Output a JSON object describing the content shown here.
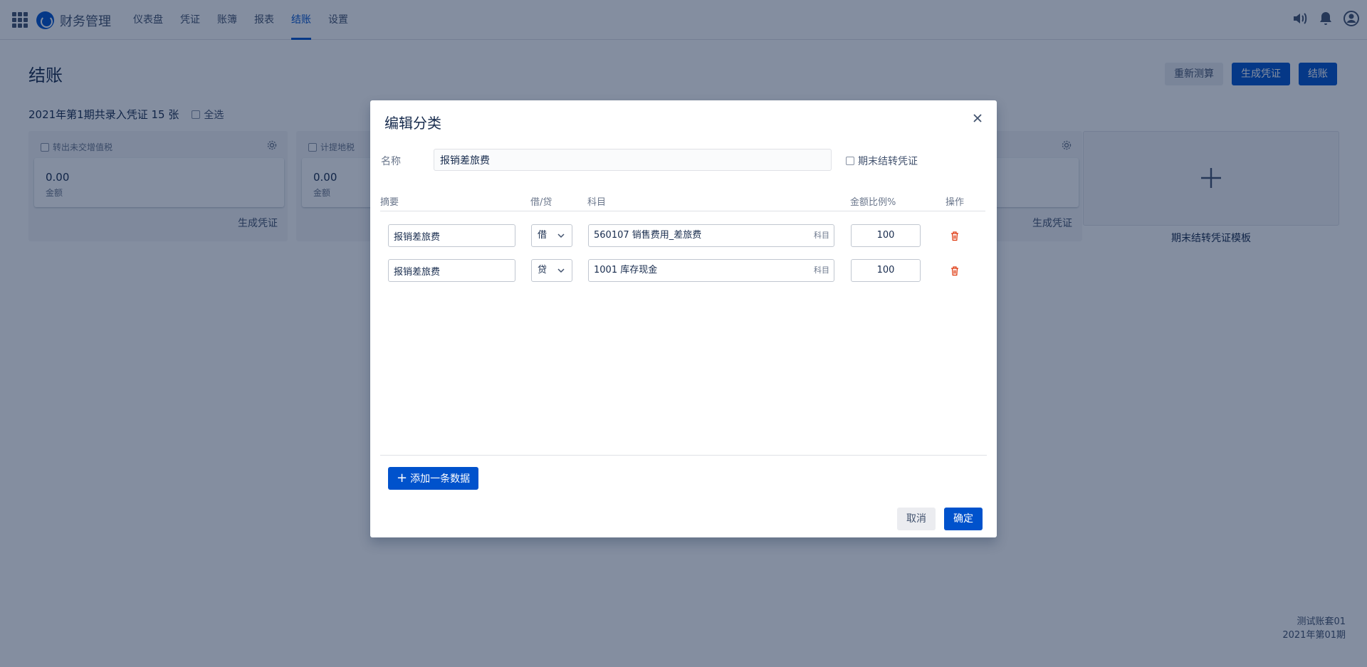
{
  "app": {
    "name": "财务管理"
  },
  "nav": [
    {
      "label": "仪表盘",
      "active": false
    },
    {
      "label": "凭证",
      "active": false
    },
    {
      "label": "账簿",
      "active": false
    },
    {
      "label": "报表",
      "active": false
    },
    {
      "label": "结账",
      "active": true
    },
    {
      "label": "设置",
      "active": false
    }
  ],
  "page": {
    "title": "结账",
    "actions": {
      "recalc": "重新测算",
      "generate": "生成凭证",
      "close": "结账"
    },
    "period_summary": "2021年第1期共录入凭证 15 张",
    "select_all": "全选"
  },
  "cards": [
    {
      "title": "转出未交增值税",
      "amount": "0.00",
      "amount_label": "金额",
      "action": "生成凭证"
    },
    {
      "title": "计提地税",
      "amount": "0.00",
      "amount_label": "金额",
      "action": "生成凭证"
    },
    {
      "action": "生成凭证"
    }
  ],
  "template_card": {
    "label": "期末结转凭证模板"
  },
  "footer": {
    "book": "测试账套01",
    "period": "2021年第01期"
  },
  "dialog": {
    "title": "编辑分类",
    "name_label": "名称",
    "name_value": "报销差旅费",
    "eop_label": "期末结转凭证",
    "columns": {
      "summary": "摘要",
      "dc": "借/贷",
      "account": "科目",
      "ratio": "金额比例%",
      "ops": "操作"
    },
    "rows": [
      {
        "summary": "报销差旅费",
        "dc": "借",
        "account": "560107 销售费用_差旅费",
        "account_tag": "科目",
        "ratio": "100"
      },
      {
        "summary": "报销差旅费",
        "dc": "贷",
        "account": "1001 库存现金",
        "account_tag": "科目",
        "ratio": "100"
      }
    ],
    "add_row": "添加一条数据",
    "cancel": "取消",
    "ok": "确定"
  },
  "colors": {
    "primary": "#0052cc",
    "danger": "#de350b",
    "overlay": "rgba(9,30,66,0.5)"
  }
}
